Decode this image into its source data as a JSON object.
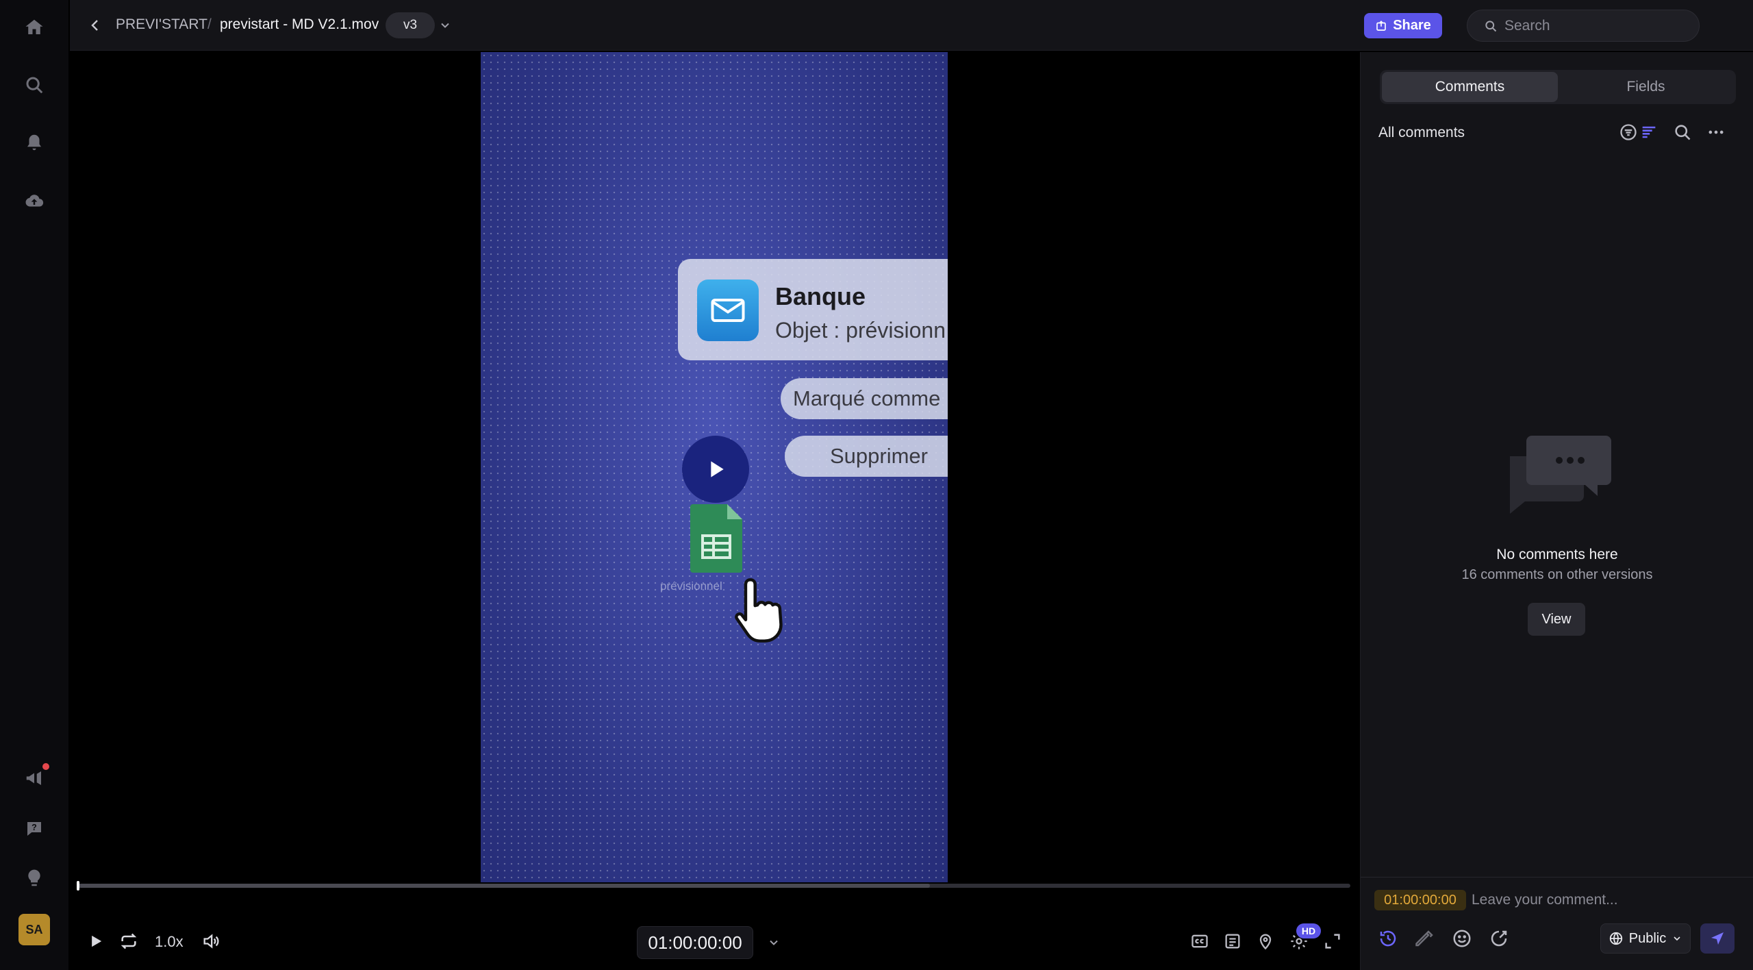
{
  "rail": {
    "avatar_initials": "SA",
    "icons": [
      "home-icon",
      "search-icon",
      "bell-icon",
      "cloud-upload-icon",
      "megaphone-icon",
      "help-icon",
      "lightbulb-icon"
    ]
  },
  "header": {
    "project": "PREVI'START",
    "separator": "/",
    "file_name": "previstart - MD V2.1.mov",
    "version": "v3",
    "share_label": "Share",
    "search_placeholder": "Search"
  },
  "video": {
    "notification_title": "Banque",
    "notification_subject": "Objet : prévisionn",
    "action_mark": "Marqué comme",
    "action_delete": "Supprimer",
    "file_label": "prévisionnel"
  },
  "player": {
    "progress": 0.0,
    "buffered": 0.67,
    "speed": "1.0x",
    "timecode": "01:00:00:00",
    "quality_badge": "HD"
  },
  "panel": {
    "tabs": [
      {
        "label": "Comments",
        "active": true
      },
      {
        "label": "Fields",
        "active": false
      }
    ],
    "list_title": "All comments",
    "empty_title": "No comments here",
    "empty_subtitle": "16 comments on other versions",
    "view_label": "View",
    "composer": {
      "timecode": "01:00:00:00",
      "placeholder": "Leave your comment...",
      "visibility": "Public"
    }
  },
  "colors": {
    "accent": "#5b54e8",
    "timecode_text": "#e3a93a",
    "avatar": "#b58a2a"
  }
}
